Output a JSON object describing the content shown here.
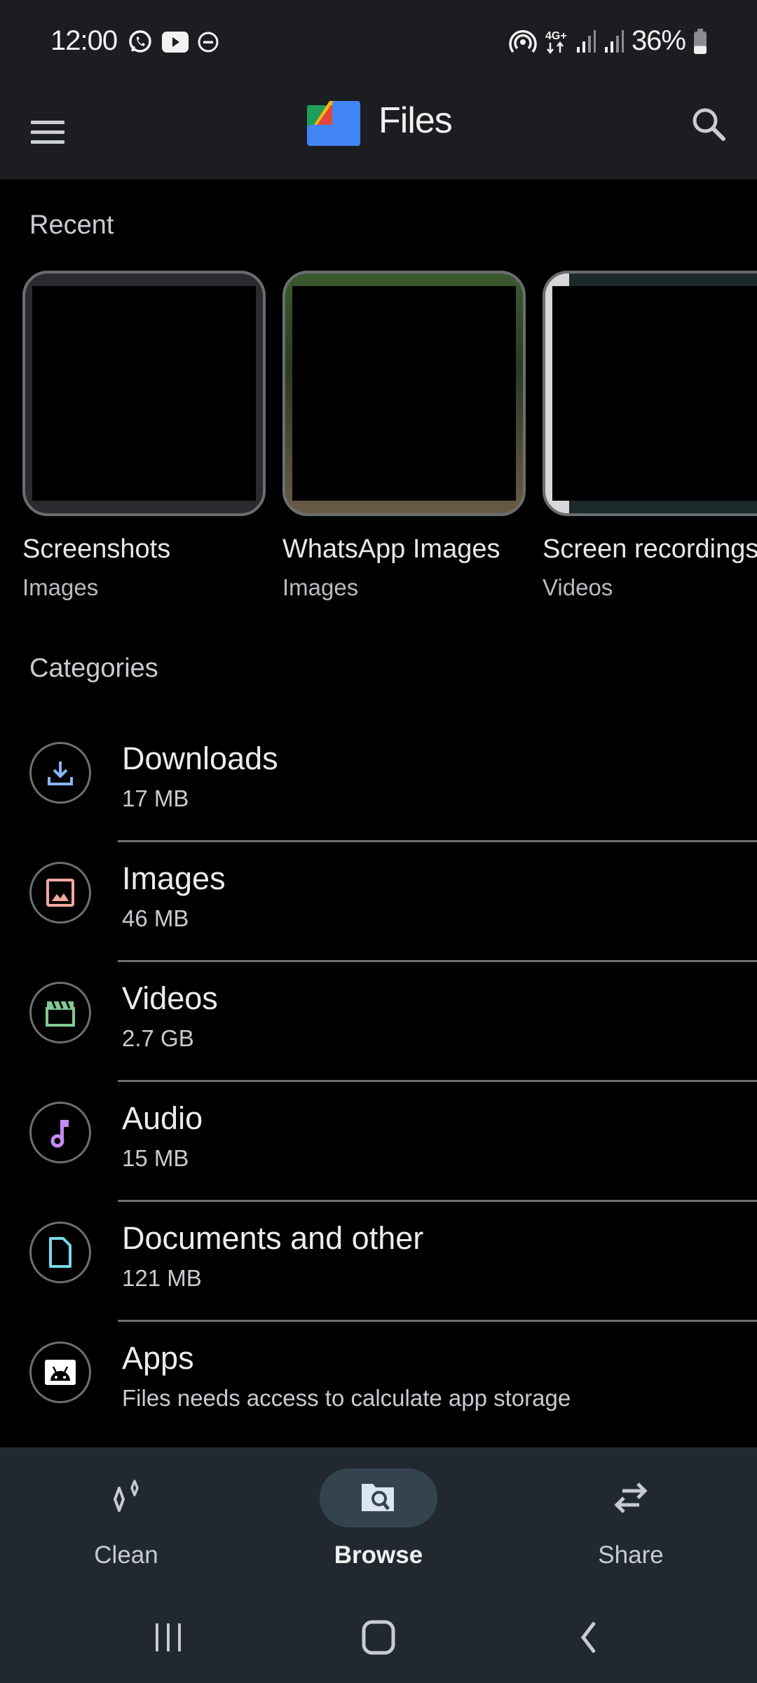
{
  "status_bar": {
    "time": "12:00",
    "left_icons": [
      "whatsapp-icon",
      "youtube-icon",
      "do-not-disturb-icon"
    ],
    "right_icons": [
      "hotspot-icon",
      "network-4g-plus-icon",
      "signal-icon",
      "signal-icon"
    ],
    "network_label": "4G+",
    "battery_percent": "36%",
    "battery_level": 0.36
  },
  "app_bar": {
    "title": "Files",
    "menu_icon": "hamburger-menu-icon",
    "search_icon": "search-icon"
  },
  "recent": {
    "title": "Recent",
    "items": [
      {
        "name": "Screenshots",
        "type": "Images"
      },
      {
        "name": "WhatsApp Images",
        "type": "Images"
      },
      {
        "name": "Screen recordings",
        "type": "Videos"
      }
    ]
  },
  "categories": {
    "title": "Categories",
    "items": [
      {
        "name": "Downloads",
        "detail": "17 MB",
        "icon": "download-icon",
        "color": "#8ab4f8"
      },
      {
        "name": "Images",
        "detail": "46 MB",
        "icon": "image-icon",
        "color": "#f2a9a1"
      },
      {
        "name": "Videos",
        "detail": "2.7 GB",
        "icon": "clapperboard-icon",
        "color": "#81c995"
      },
      {
        "name": "Audio",
        "detail": "15 MB",
        "icon": "music-note-icon",
        "color": "#c58af9"
      },
      {
        "name": "Documents and other",
        "detail": "121 MB",
        "icon": "document-icon",
        "color": "#78d9ec"
      },
      {
        "name": "Apps",
        "detail": "Files needs access to calculate app storage",
        "icon": "android-icon",
        "color": "#ffffff"
      }
    ]
  },
  "bottom_nav": {
    "items": [
      {
        "label": "Clean",
        "icon": "sparkle-icon",
        "active": false
      },
      {
        "label": "Browse",
        "icon": "folder-search-icon",
        "active": true
      },
      {
        "label": "Share",
        "icon": "swap-arrows-icon",
        "active": false
      }
    ]
  },
  "system_nav": [
    "recents-icon",
    "home-icon",
    "back-icon"
  ]
}
